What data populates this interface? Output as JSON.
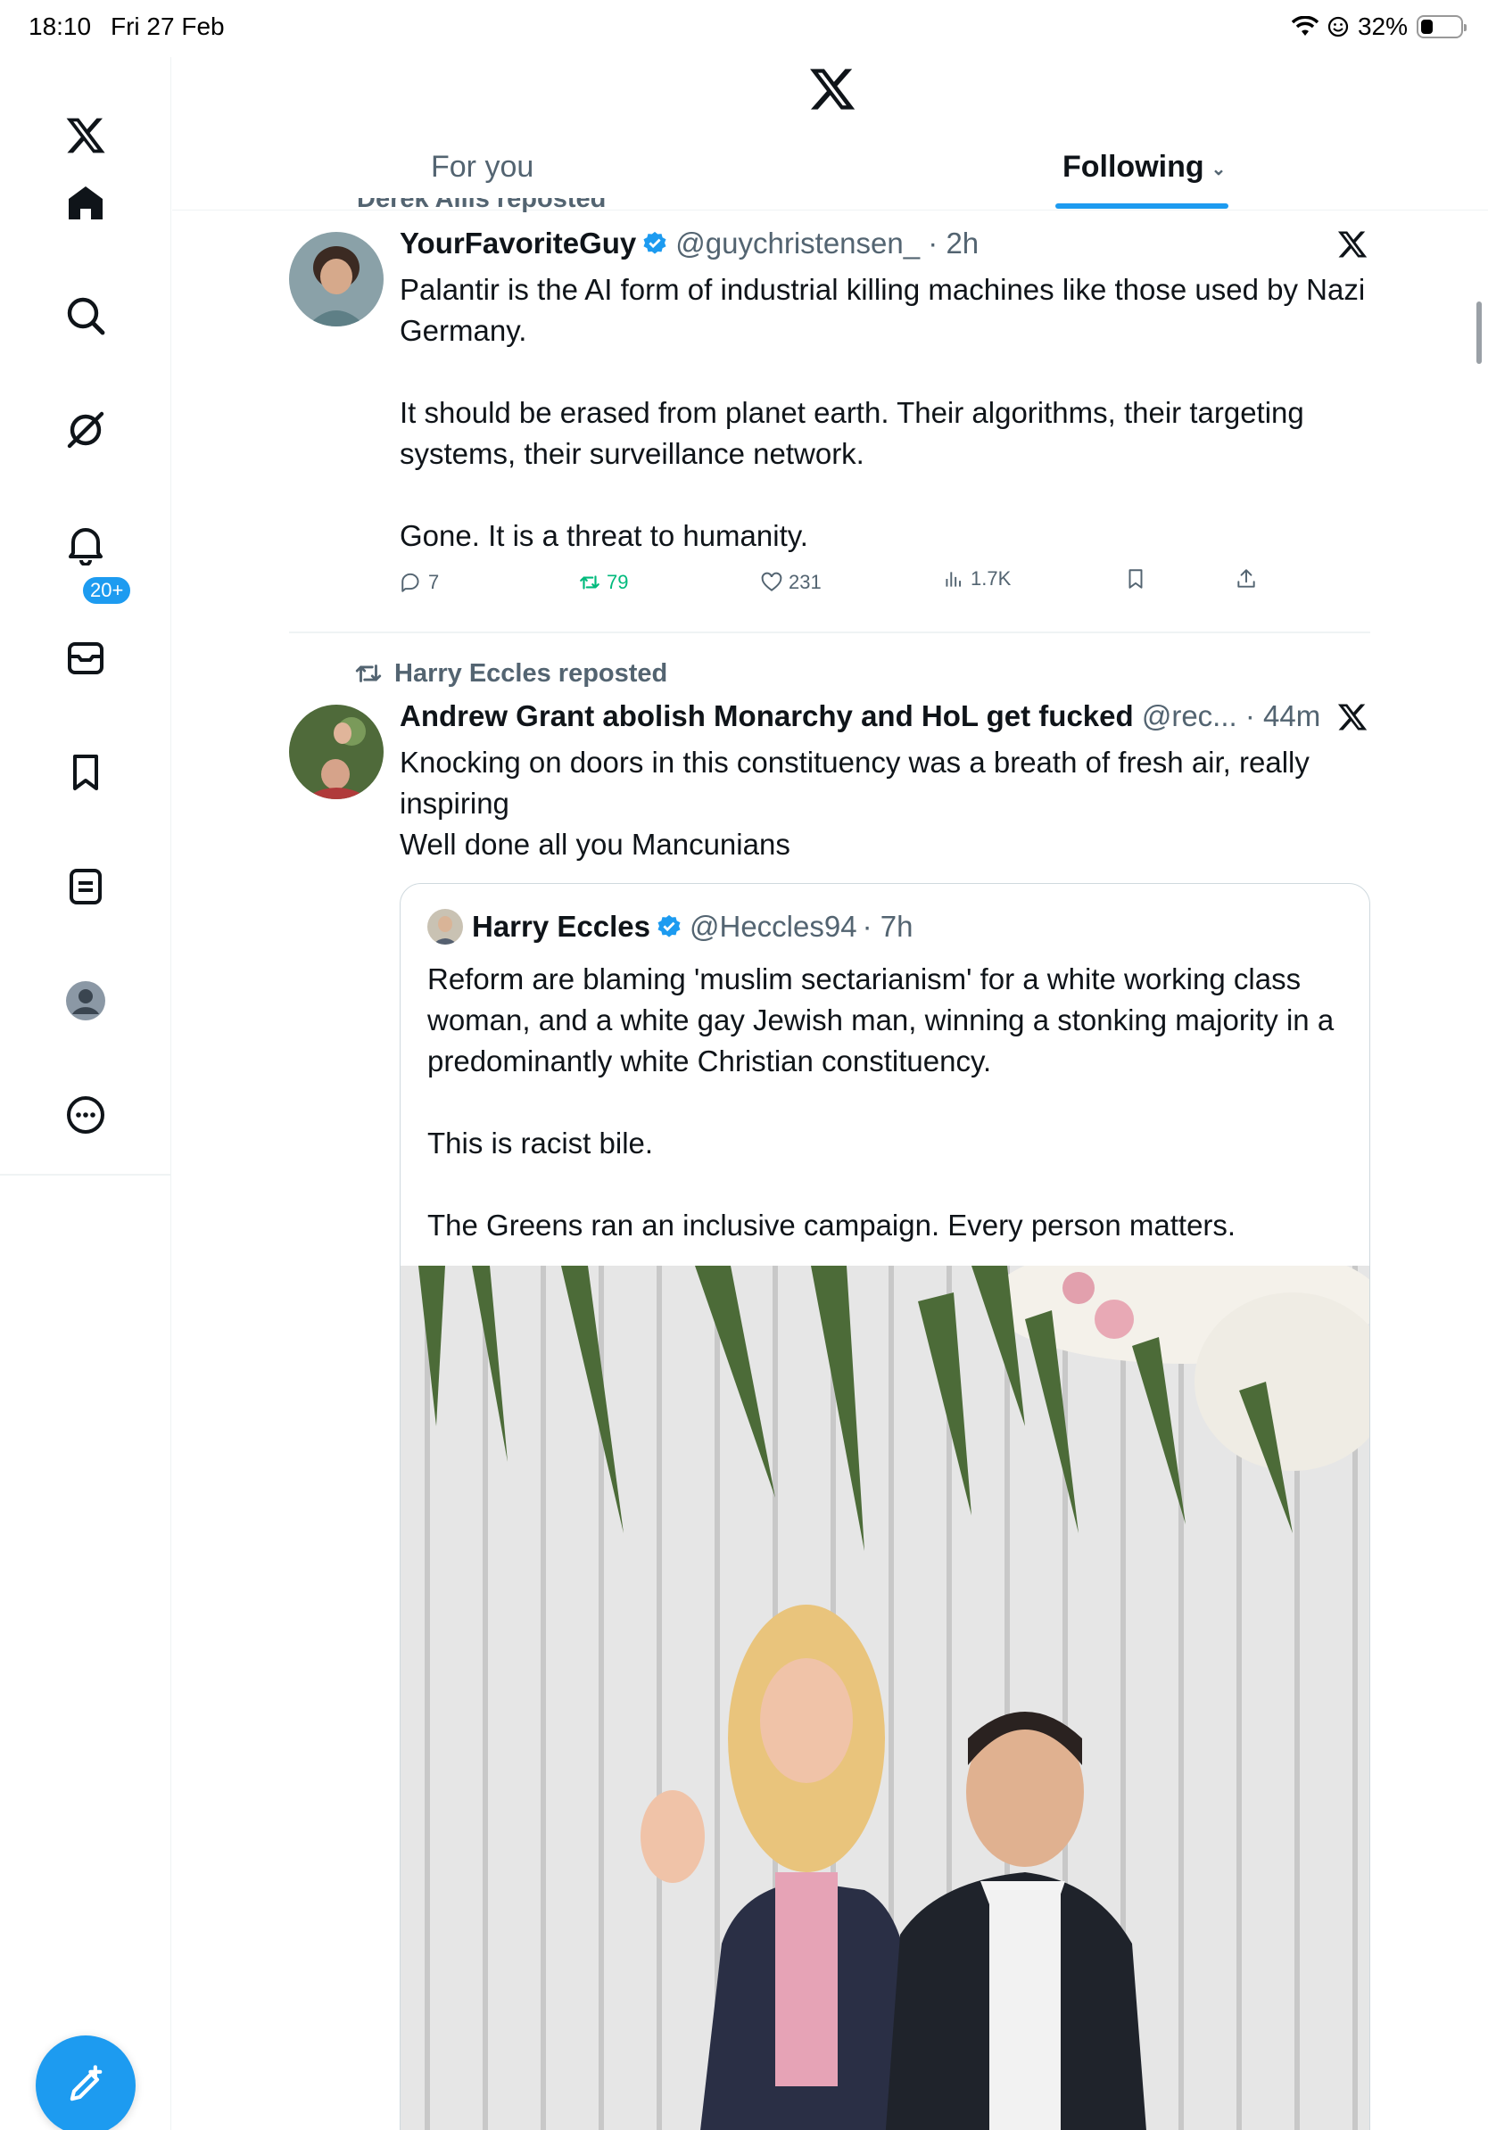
{
  "status_bar": {
    "time": "18:10",
    "date": "Fri 27 Feb",
    "battery_percent": "32%",
    "battery_level": 0.32
  },
  "sidebar": {
    "items": [
      {
        "icon": "x-logo-icon"
      },
      {
        "icon": "home-icon"
      },
      {
        "icon": "search-icon"
      },
      {
        "icon": "grok-icon"
      },
      {
        "icon": "bell-icon"
      },
      {
        "icon": "mail-icon"
      },
      {
        "icon": "bookmark-icon"
      },
      {
        "icon": "lists-icon"
      },
      {
        "icon": "profile-icon"
      },
      {
        "icon": "more-icon"
      }
    ],
    "notification_badge": "20+",
    "compose_icon": "compose-icon"
  },
  "header": {
    "tabs": [
      {
        "label": "For you",
        "active": false
      },
      {
        "label": "Following",
        "active": true
      }
    ]
  },
  "feed": {
    "partial_repost_label": "Derek Allis reposted",
    "tweets": [
      {
        "name": "YourFavoriteGuy",
        "verified": true,
        "handle": "@guychristensen_",
        "time": "· 2h",
        "text": "Palantir is the AI form of industrial killing machines like those used by Nazi Germany.\n\nIt should be erased from planet earth. Their algorithms, their targeting systems, their surveillance network.\n\nGone. It is a threat to humanity.",
        "stats": {
          "replies": "7",
          "reposts": "79",
          "likes": "231",
          "views": "1.7K"
        }
      },
      {
        "repost_label": "Harry Eccles reposted",
        "name": "Andrew Grant abolish Monarchy and HoL get fucked",
        "handle": "@rec...",
        "time": "· 44m",
        "text": "Knocking on doors in this constituency was a breath of fresh air, really inspiring\nWell done all you Mancunians",
        "quote": {
          "name": "Harry Eccles",
          "verified": true,
          "handle": "@Heccles94",
          "time": "· 7h",
          "text": "Reform are blaming 'muslim sectarianism' for a white working class woman, and a white gay Jewish man, winning a stonking majority in a predominantly white Christian constituency.\n\nThis is racist bile.\n\nThe Greens ran an inclusive campaign. Every person matters."
        }
      }
    ]
  },
  "colors": {
    "accent": "#1d9bf0",
    "repost_green": "#00ba7c",
    "secondary_text": "#536471",
    "primary_text": "#0f1419"
  }
}
